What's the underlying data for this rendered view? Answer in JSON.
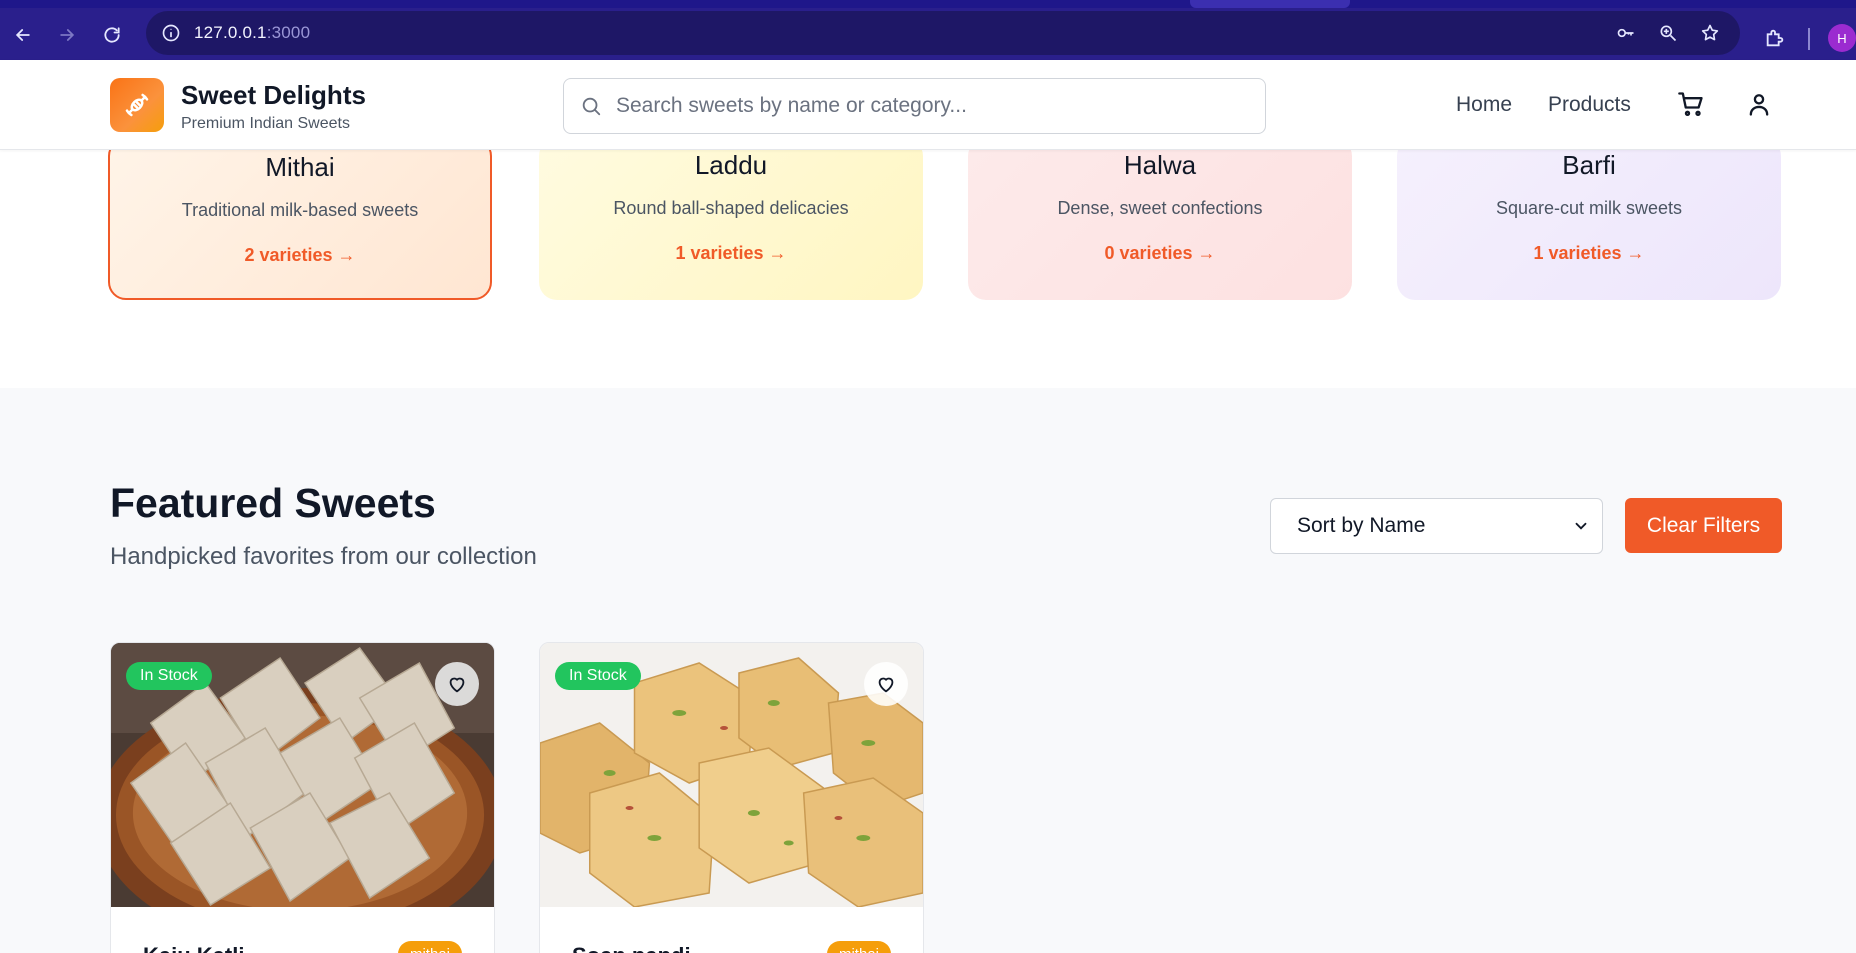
{
  "browser": {
    "url_host": "127.0.0.1",
    "url_port": ":3000",
    "profile_initial": "H"
  },
  "header": {
    "brand_name": "Sweet Delights",
    "brand_tagline": "Premium Indian Sweets",
    "search_placeholder": "Search sweets by name or category...",
    "nav": [
      "Home",
      "Products"
    ],
    "accent_color": "#f05a28"
  },
  "categories": [
    {
      "name": "Mithai",
      "description": "Traditional milk-based sweets",
      "count_label": "2 varieties →",
      "bg": "#ffedd9"
    },
    {
      "name": "Laddu",
      "description": "Round ball-shaped delicacies",
      "count_label": "1 varieties →",
      "bg": "#fff9d6"
    },
    {
      "name": "Halwa",
      "description": "Dense, sweet confections",
      "count_label": "0 varieties →",
      "bg": "#fde4e4"
    },
    {
      "name": "Barfi",
      "description": "Square-cut milk sweets",
      "count_label": "1 varieties →",
      "bg": "#efe9fb"
    }
  ],
  "featured": {
    "title": "Featured Sweets",
    "subtitle": "Handpicked favorites from our collection",
    "sort_label": "Sort by Name",
    "clear_label": "Clear Filters"
  },
  "products": [
    {
      "name": "Kaju Katli",
      "stock": "In Stock",
      "category": "mithai"
    },
    {
      "name": "Soan papdi",
      "stock": "In Stock",
      "category": "mithai"
    }
  ]
}
